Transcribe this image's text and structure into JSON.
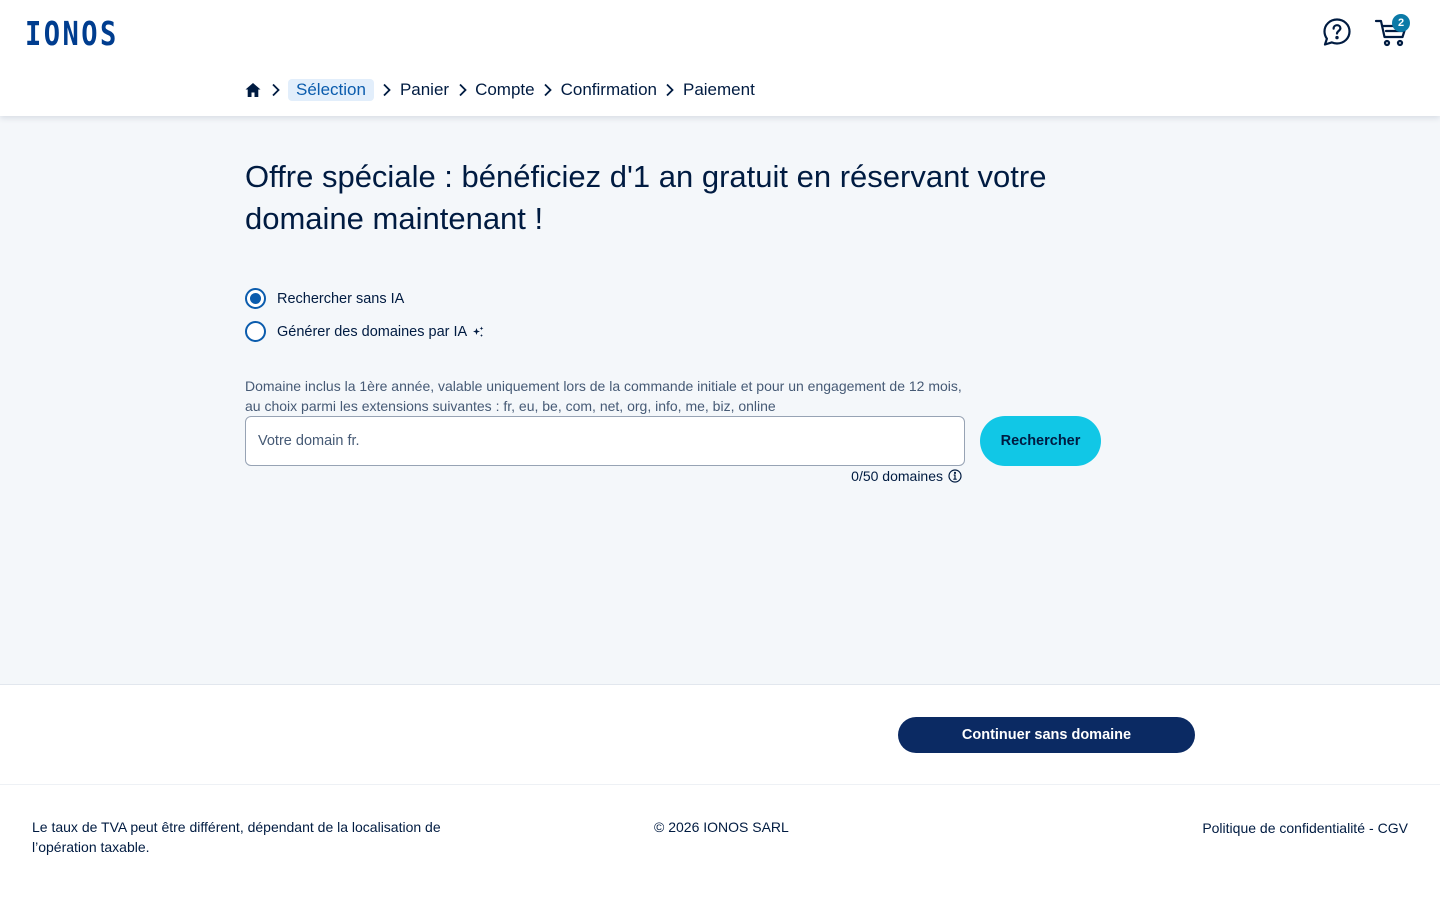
{
  "header": {
    "logo_text": "IONOS",
    "help_icon": "help-chat-icon",
    "cart_icon": "cart-icon",
    "cart_count": "2"
  },
  "breadcrumb": {
    "home_icon": "home-icon",
    "items": [
      {
        "label": "Sélection",
        "active": true
      },
      {
        "label": "Panier"
      },
      {
        "label": "Compte"
      },
      {
        "label": "Confirmation"
      },
      {
        "label": "Paiement"
      }
    ]
  },
  "main": {
    "headline": "Offre spéciale : bénéficiez d'1 an gratuit en réservant votre domaine maintenant !",
    "search_modes": [
      {
        "label": "Rechercher sans IA",
        "selected": true
      },
      {
        "label": "Générer des domaines par IA",
        "selected": false,
        "icon": "sparkle-icon"
      }
    ],
    "info_text": "Domaine inclus la 1ère année, valable uniquement lors de la commande initiale et pour un engagement de 12 mois, au choix parmi les extensions suivantes : fr, eu, be, com, net, org, info, me, biz, online",
    "search": {
      "placeholder": "Votre domain fr.",
      "value": "",
      "button_label": "Rechercher"
    },
    "counter_text": "0/50 domaines"
  },
  "actions": {
    "continue_label": "Continuer sans domaine"
  },
  "footer": {
    "vat_text": "Le taux de TVA peut être différent, dépendant de la localisation de l’opération taxable.",
    "copyright": "© 2026 IONOS SARL",
    "privacy_link": "Politique de confidentialité",
    "separator": "-",
    "cgv_link": "CGV"
  },
  "colors": {
    "brand_dark": "#001b41",
    "brand_blue": "#003d8f",
    "accent_cyan": "#11c7e6",
    "button_navy": "#0b2a63",
    "page_bg": "#f4f7fa"
  }
}
